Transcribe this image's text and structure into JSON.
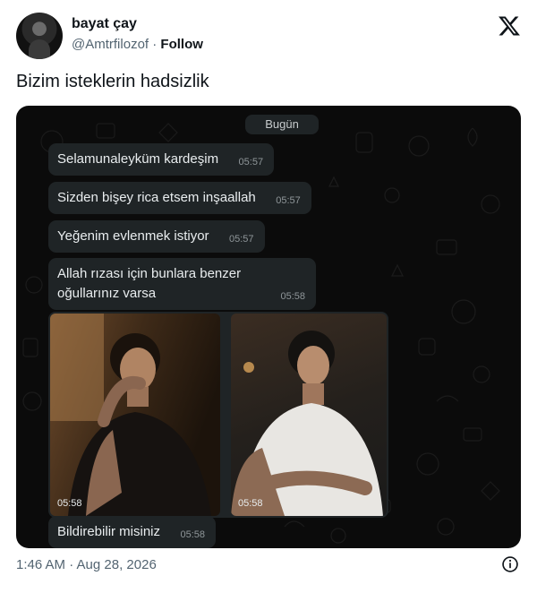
{
  "author": {
    "name": "bayat çay",
    "handle": "@Amtrfilozof",
    "separator": "·",
    "follow_label": "Follow"
  },
  "tweet": {
    "text": "Bizim isteklerin hadsizlik",
    "timestamp": "1:46 AM · Aug 28, 2026"
  },
  "chat": {
    "day_label": "Bugün",
    "messages": [
      {
        "text": "Selamunaleyküm kardeşim",
        "time": "05:57"
      },
      {
        "text": "Sizden bişey rica etsem inşaallah",
        "time": "05:57"
      },
      {
        "text": "Yeğenim evlenmek istiyor",
        "time": "05:57"
      },
      {
        "text_line1": "Allah rızası için bunlara benzer",
        "text_line2": "oğullarınız varsa",
        "time": "05:58"
      },
      {
        "text": "Bildirebilir misiniz",
        "time": "05:58"
      }
    ],
    "photos": [
      {
        "time": "05:58"
      },
      {
        "time": "05:58"
      }
    ]
  },
  "icons": {
    "logo": "x-logo-icon",
    "info": "info-icon"
  }
}
